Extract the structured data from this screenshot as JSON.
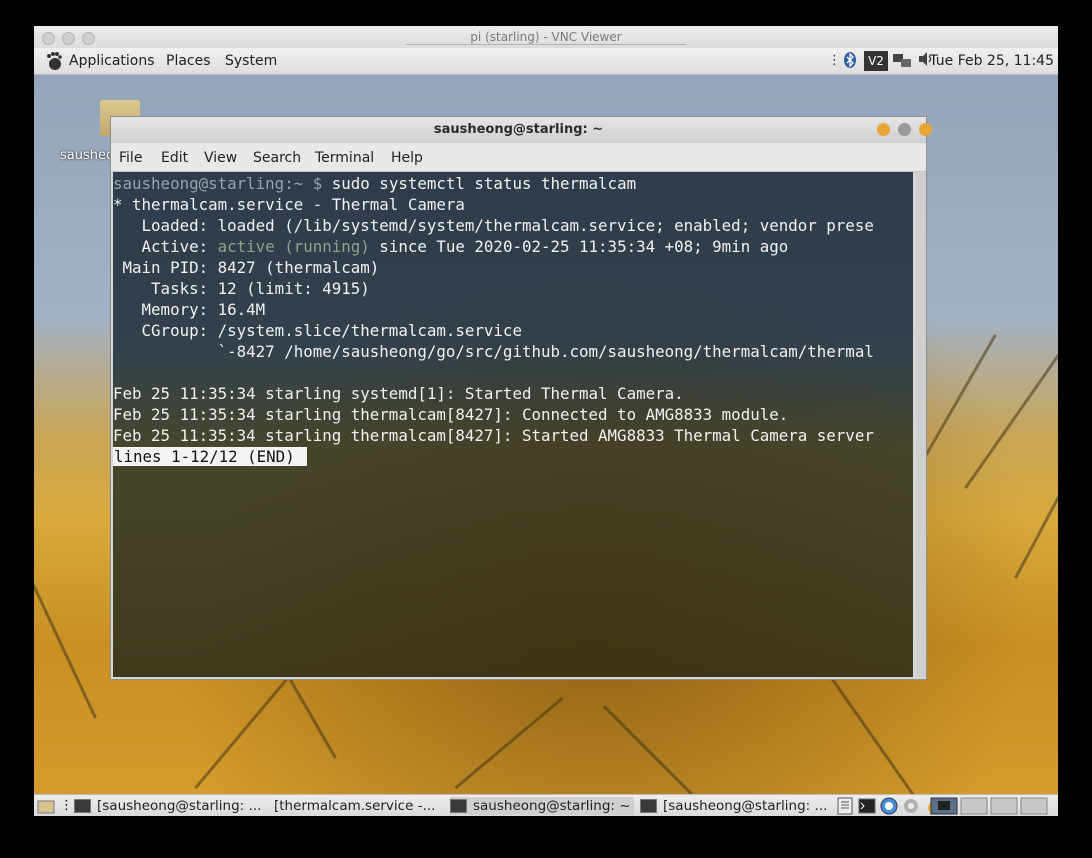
{
  "vnc": {
    "title": "pi (starling) - VNC Viewer"
  },
  "top_panel": {
    "menus": [
      "Applications",
      "Places",
      "System"
    ],
    "clock": "Tue Feb 25, 11:45",
    "tray_icons": [
      "more-icon",
      "bluetooth-icon",
      "vnc-icon",
      "network-icon",
      "volume-icon"
    ]
  },
  "desktop": {
    "home_label": "sausheong"
  },
  "terminal": {
    "title": "sausheong@starling: ~",
    "menus": [
      "File",
      "Edit",
      "View",
      "Search",
      "Terminal",
      "Help"
    ],
    "prompt": "sausheong@starling:~ $",
    "command": "sudo systemctl status thermalcam",
    "lines": {
      "service": "* thermalcam.service - Thermal Camera",
      "loaded": "   Loaded: loaded (/lib/systemd/system/thermalcam.service; enabled; vendor prese",
      "active_label": "   Active: ",
      "active_state": "active (running)",
      "active_since": " since Tue 2020-02-25 11:35:34 +08; 9min ago",
      "main_pid": " Main PID: 8427 (thermalcam)",
      "tasks": "    Tasks: 12 (limit: 4915)",
      "memory": "   Memory: 16.4M",
      "cgroup": "   CGroup: /system.slice/thermalcam.service",
      "cgroup_child": "           `-8427 /home/sausheong/go/src/github.com/sausheong/thermalcam/thermal",
      "log1": "Feb 25 11:35:34 starling systemd[1]: Started Thermal Camera.",
      "log2": "Feb 25 11:35:34 starling thermalcam[8427]: Connected to AMG8833 module.",
      "log3": "Feb 25 11:35:34 starling thermalcam[8427]: Started AMG8833 Thermal Camera server"
    },
    "pager": "lines 1-12/12 (END)"
  },
  "taskbar": {
    "tasks": [
      "[sausheong@starling: ...",
      "[thermalcam.service -...",
      "sausheong@starling: ~",
      "[sausheong@starling: ..."
    ]
  }
}
